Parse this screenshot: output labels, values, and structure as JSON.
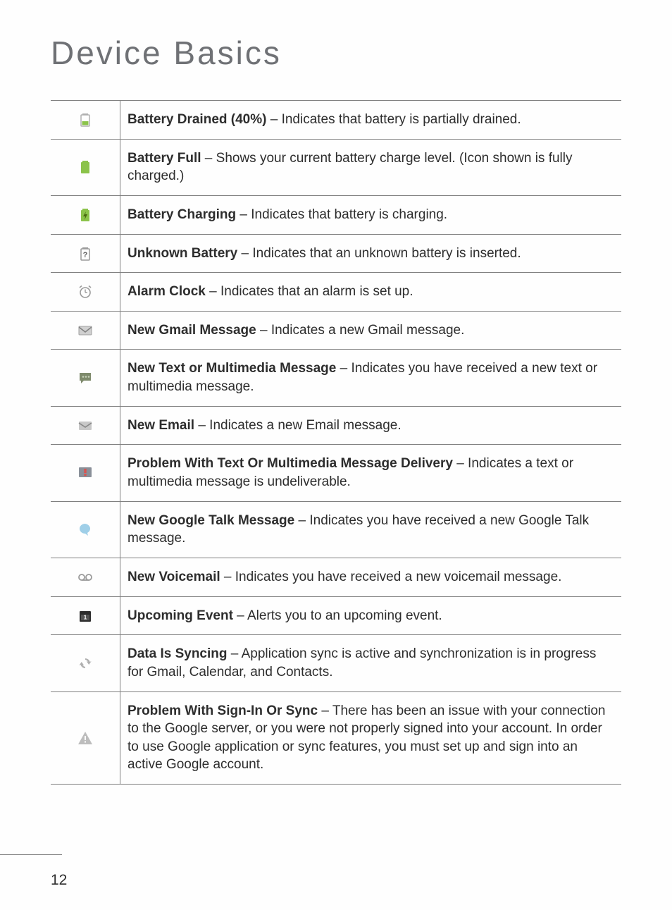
{
  "page_title": "Device Basics",
  "page_number": "12",
  "rows": [
    {
      "icon_name": "battery-drained-icon",
      "title": "Battery Drained (40%)",
      "desc": " – Indicates that battery is partially drained."
    },
    {
      "icon_name": "battery-full-icon",
      "title": "Battery Full",
      "desc": " – Shows your current battery charge level. (Icon shown is fully charged.)"
    },
    {
      "icon_name": "battery-charging-icon",
      "title": "Battery Charging",
      "desc": " – Indicates that battery is charging."
    },
    {
      "icon_name": "unknown-battery-icon",
      "title": "Unknown Battery",
      "desc": " – Indicates that an unknown battery is inserted."
    },
    {
      "icon_name": "alarm-clock-icon",
      "title": "Alarm Clock",
      "desc": " – Indicates that an alarm is set up."
    },
    {
      "icon_name": "gmail-message-icon",
      "title": "New Gmail Message",
      "desc": " – Indicates a new Gmail message."
    },
    {
      "icon_name": "new-text-mms-icon",
      "title": "New Text or Multimedia Message",
      "desc": " – Indicates you have received a new text or multimedia message."
    },
    {
      "icon_name": "new-email-icon",
      "title": "New Email",
      "desc": " – Indicates a new Email message."
    },
    {
      "icon_name": "message-problem-icon",
      "title": "Problem With Text Or Multimedia Message Delivery",
      "desc": " – Indicates a text or multimedia message is undeliverable."
    },
    {
      "icon_name": "gtalk-message-icon",
      "title": "New Google Talk Message",
      "desc": " – Indicates you have received a new Google Talk message."
    },
    {
      "icon_name": "voicemail-icon",
      "title": "New Voicemail",
      "desc": " – Indicates you have received a new voicemail message."
    },
    {
      "icon_name": "upcoming-event-icon",
      "title": "Upcoming Event",
      "desc": " – Alerts you to an upcoming event."
    },
    {
      "icon_name": "data-syncing-icon",
      "title": "Data Is Syncing",
      "desc": " – Application sync is active and synchronization is in progress for Gmail, Calendar, and Contacts."
    },
    {
      "icon_name": "sync-problem-icon",
      "title": "Problem With Sign-In Or Sync",
      "desc": " – There has been an issue with your connection to the Google server, or you were not properly signed into your account. In order to use Google application or sync features, you must set up and sign into an active Google account."
    }
  ]
}
